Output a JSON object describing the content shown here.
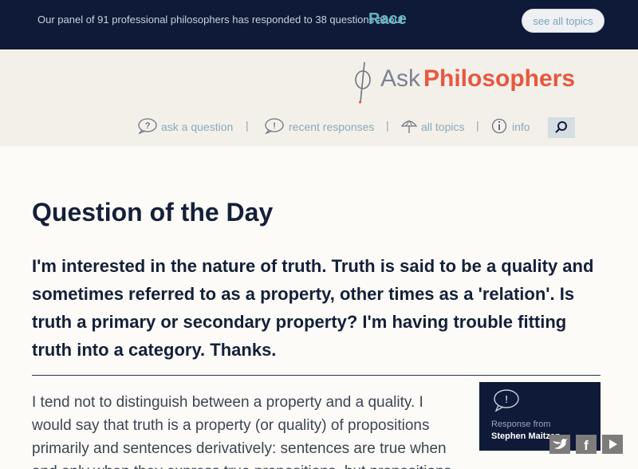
{
  "banner": {
    "intro": "Our panel of 91 professional philosophers has responded to 38 questions about",
    "topic": "Race",
    "see_all": "see all topics"
  },
  "brand": {
    "ask": "Ask",
    "philosophers": "Philosophers"
  },
  "nav": {
    "ask": "ask a question",
    "recent": "recent responses",
    "topics": "all topics",
    "info": "info",
    "separator": "|"
  },
  "main": {
    "heading": "Question of the Day",
    "question": "I'm interested in the nature of truth. Truth is said to be a quality and sometimes referred to as a property, other times as a 'relation'. Is truth a primary or secondary property? I'm having trouble fitting truth into a category. Thanks.",
    "answer": "I tend not to distinguish between a property and a quality. I would say that truth is a property (or quality) of propositions primarily and sentences derivatively: sentences are true when and only when they express true propositions, but propositions"
  },
  "response_card": {
    "label": "Response from",
    "author": "Stephen Maitzen"
  },
  "colors": {
    "banner": "#0e1a37",
    "accent": "#e8573f",
    "topic": "#5fb7c4",
    "nav": "#8aaab6"
  },
  "icons": [
    "question-bubble-icon",
    "exclamation-bubble-icon",
    "umbrella-icon",
    "info-icon",
    "search-icon",
    "twitter-icon",
    "facebook-icon",
    "youtube-icon"
  ]
}
